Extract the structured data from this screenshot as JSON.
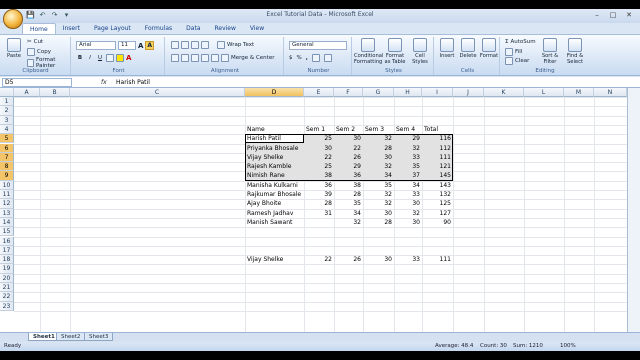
{
  "window": {
    "title": "Excel Tutorial Data - Microsoft Excel",
    "buttons": [
      "–",
      "□",
      "✕"
    ]
  },
  "quick_access": [
    "💾",
    "↶",
    "↷",
    "▾"
  ],
  "tabs": [
    "Home",
    "Insert",
    "Page Layout",
    "Formulas",
    "Data",
    "Review",
    "View"
  ],
  "ribbon": {
    "clipboard": {
      "label": "Clipboard",
      "paste": "Paste",
      "cut": "Cut",
      "copy": "Copy",
      "format_painter": "Format Painter"
    },
    "font": {
      "label": "Font",
      "family": "Arial",
      "size": "11",
      "bold": "B",
      "italic": "I",
      "underline": "U"
    },
    "alignment": {
      "label": "Alignment",
      "wrap": "Wrap Text",
      "merge": "Merge & Center"
    },
    "number": {
      "label": "Number",
      "format": "General",
      "currency": "$",
      "percent": "%",
      "comma": ","
    },
    "styles": {
      "label": "Styles",
      "cond": "Conditional Formatting",
      "table": "Format as Table",
      "cell": "Cell Styles"
    },
    "cells": {
      "label": "Cells",
      "insert": "Insert",
      "delete": "Delete",
      "format": "Format"
    },
    "editing": {
      "label": "Editing",
      "autosum": "AutoSum",
      "fill": "Fill",
      "clear": "Clear",
      "sort": "Sort & Filter",
      "find": "Find & Select"
    }
  },
  "formula_bar": {
    "name_box": "D5",
    "fx": "fx",
    "value": "Harish Patil"
  },
  "columns": [
    "A",
    "B",
    "C",
    "D",
    "E",
    "F",
    "G",
    "H",
    "I",
    "J",
    "K",
    "L",
    "M",
    "N"
  ],
  "rows": [
    "1",
    "2",
    "3",
    "4",
    "5",
    "6",
    "7",
    "8",
    "9",
    "10",
    "11",
    "12",
    "13",
    "14",
    "15",
    "16",
    "17",
    "18",
    "19",
    "20",
    "21",
    "22",
    "23"
  ],
  "header_row": {
    "name": "Name",
    "s1": "Sem 1",
    "s2": "Sem 2",
    "s3": "Sem 3",
    "s4": "Sem 4",
    "total": "Total"
  },
  "data_rows": [
    {
      "row": "5",
      "name": "Harish Patil",
      "v": [
        "25",
        "30",
        "32",
        "29",
        "116"
      ]
    },
    {
      "row": "6",
      "name": "Priyanka Bhosale",
      "v": [
        "30",
        "22",
        "28",
        "32",
        "112"
      ]
    },
    {
      "row": "7",
      "name": "Vijay Shelke",
      "v": [
        "22",
        "26",
        "30",
        "33",
        "111"
      ]
    },
    {
      "row": "8",
      "name": "Rajesh Kamble",
      "v": [
        "25",
        "29",
        "32",
        "35",
        "121"
      ]
    },
    {
      "row": "9",
      "name": "Nimish Rane",
      "v": [
        "38",
        "36",
        "34",
        "37",
        "145"
      ]
    },
    {
      "row": "10",
      "name": "Manisha Kulkarni",
      "v": [
        "36",
        "38",
        "35",
        "34",
        "143"
      ]
    },
    {
      "row": "11",
      "name": "Rajkumar Bhosale",
      "v": [
        "39",
        "28",
        "32",
        "33",
        "132"
      ]
    },
    {
      "row": "12",
      "name": "Ajay Bhoite",
      "v": [
        "28",
        "35",
        "32",
        "30",
        "125"
      ]
    },
    {
      "row": "13",
      "name": "Ramesh Jadhav",
      "v": [
        "31",
        "34",
        "30",
        "32",
        "127"
      ]
    },
    {
      "row": "14",
      "name": "Manish Sawant",
      "v": [
        "",
        "32",
        "28",
        "30",
        "90"
      ]
    },
    {
      "row": "18",
      "name": "Vijay Shelke",
      "v": [
        "22",
        "26",
        "30",
        "33",
        "111"
      ]
    }
  ],
  "sheets": [
    "Sheet1",
    "Sheet2",
    "Sheet3"
  ],
  "status": {
    "ready": "Ready",
    "average": "Average: 48.4",
    "count": "Count: 30",
    "sum": "Sum: 1210",
    "zoom": "100%"
  }
}
